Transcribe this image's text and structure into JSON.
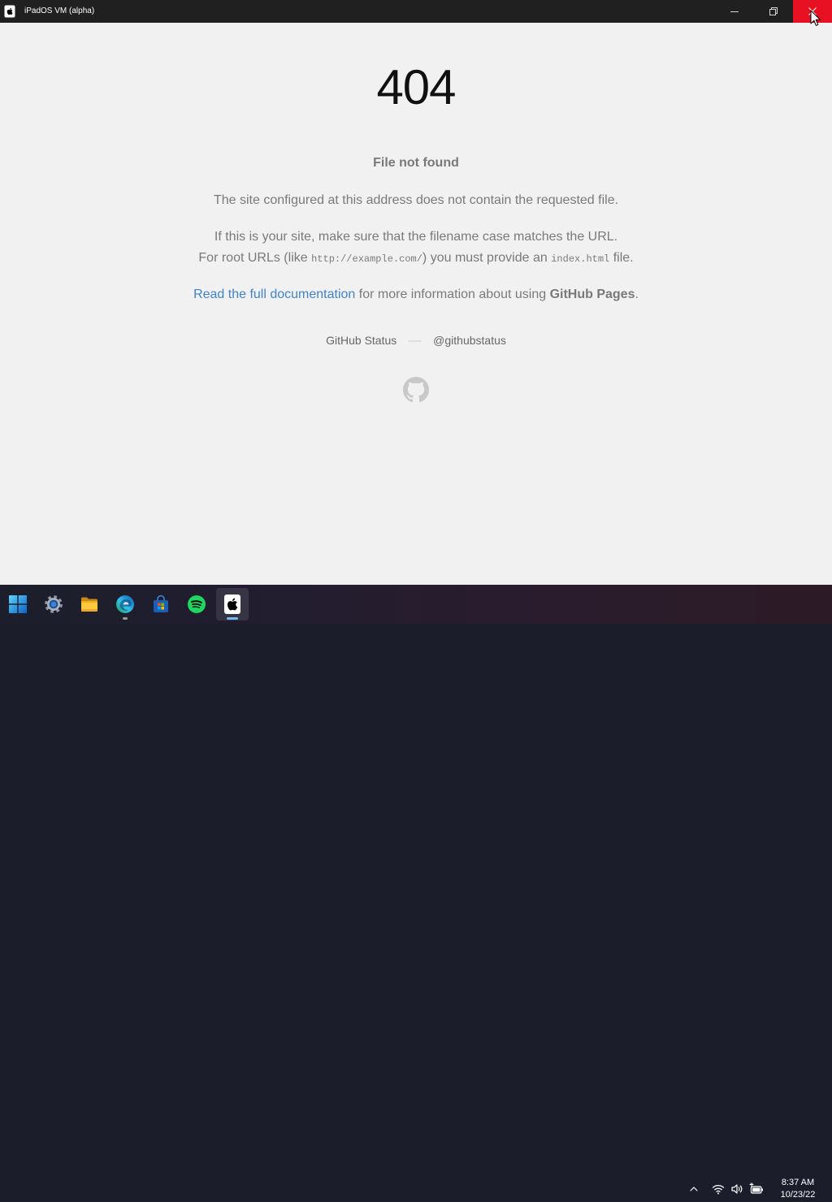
{
  "window": {
    "title": "iPadOS VM (alpha)",
    "app_icon": "ipad-apple-icon",
    "controls": [
      {
        "icon": "minimize-icon"
      },
      {
        "icon": "restore-icon"
      },
      {
        "icon": "close-icon",
        "hovered": true
      }
    ]
  },
  "page": {
    "heading": "404",
    "status": "File not found",
    "message": "The site configured at this address does not contain the requested file.",
    "help": {
      "line1": "If this is your site, make sure that the filename case matches the URL.",
      "line2_before": "For root URLs (like",
      "example_url": "http://example.com/",
      "line2_middle": ") you must provide an",
      "index_file": "index.html",
      "line2_after": "file."
    },
    "docs": {
      "link_text": "Read the full documentation",
      "middle": "for more information about using",
      "product": "GitHub Pages",
      "end": "."
    },
    "suggestions": {
      "status_link": "GitHub Status",
      "separator": "—",
      "twitter_link": "@githubstatus"
    },
    "logo_icon": "github-octocat-icon"
  },
  "taskbar": {
    "apps": [
      {
        "icon": "windows-start-icon",
        "running": false,
        "active": false
      },
      {
        "icon": "settings-gear-icon",
        "running": false,
        "active": false
      },
      {
        "icon": "file-explorer-folder-icon",
        "running": false,
        "active": false
      },
      {
        "icon": "edge-browser-icon",
        "running": true,
        "active": false
      },
      {
        "icon": "microsoft-store-icon",
        "running": false,
        "active": false
      },
      {
        "icon": "spotify-icon",
        "running": false,
        "active": false
      },
      {
        "icon": "ipados-vm-apple-icon",
        "running": true,
        "active": true
      }
    ],
    "tray": {
      "icons": [
        "chevron-up-icon",
        "wifi-icon",
        "volume-icon",
        "battery-charging-icon"
      ]
    },
    "clock": {
      "time": "8:37 AM",
      "date": "10/23/22"
    }
  },
  "colors": {
    "page_background": "#f1f1f1",
    "link": "#4183c4",
    "close_button": "#e81123",
    "titlebar": "#202020",
    "active_indicator": "#76b9ed",
    "running_indicator": "#9a9a9a",
    "logo": "#c8c8c8"
  }
}
